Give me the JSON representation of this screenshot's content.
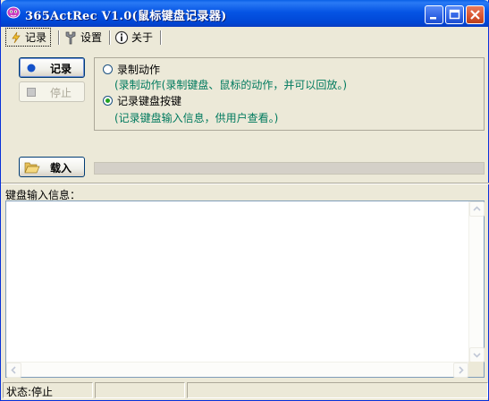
{
  "window": {
    "title": "365ActRec V1.0(鼠标键盘记录器)"
  },
  "tabs": [
    {
      "label": "记录",
      "icon": "lightning-icon",
      "active": true
    },
    {
      "label": "设置",
      "icon": "tools-icon",
      "active": false
    },
    {
      "label": "关于",
      "icon": "info-icon",
      "active": false
    }
  ],
  "buttons": {
    "record": "记录",
    "stop": "停止",
    "load": "载入"
  },
  "options": {
    "action_label": "录制动作",
    "action_desc": "(录制动作(录制键盘、鼠标的动作，并可以回放。)",
    "keys_label": "记录键盘按键",
    "keys_desc": "(记录键盘输入信息，供用户查看。)",
    "selected": "keys"
  },
  "keyboard_panel": {
    "label": "键盘输入信息：",
    "value": ""
  },
  "status": {
    "text": "状态:停止"
  },
  "colors": {
    "title_bar": "#0054e3",
    "desc_text": "#007a5e",
    "record_dot": "#1552c9",
    "close_button": "#d8532e"
  }
}
